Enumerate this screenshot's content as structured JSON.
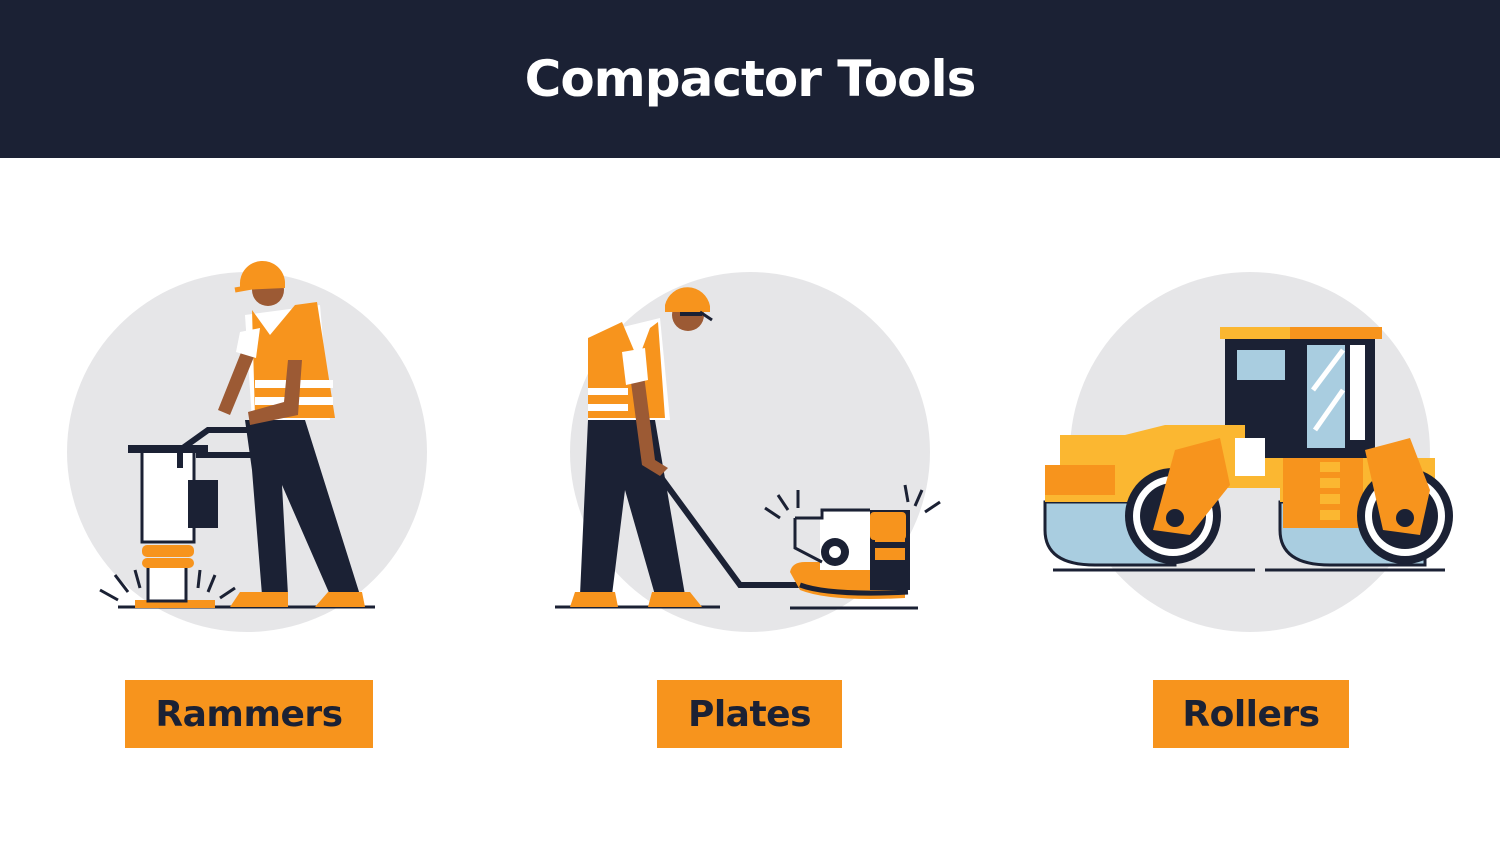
{
  "page": {
    "title": "Compactor Tools"
  },
  "tools": [
    {
      "label": "Rammers",
      "icon": "rammer-worker-illustration"
    },
    {
      "label": "Plates",
      "icon": "plate-compactor-worker-illustration"
    },
    {
      "label": "Rollers",
      "icon": "road-roller-illustration"
    }
  ],
  "colors": {
    "header_bg": "#1b2134",
    "accent_orange": "#f7941d",
    "roller_yellow": "#fbb731",
    "circle_gray": "#e6e6e8",
    "navy": "#1b2134",
    "skin": "#9c5a34",
    "drum_blue": "#a9cde0"
  }
}
